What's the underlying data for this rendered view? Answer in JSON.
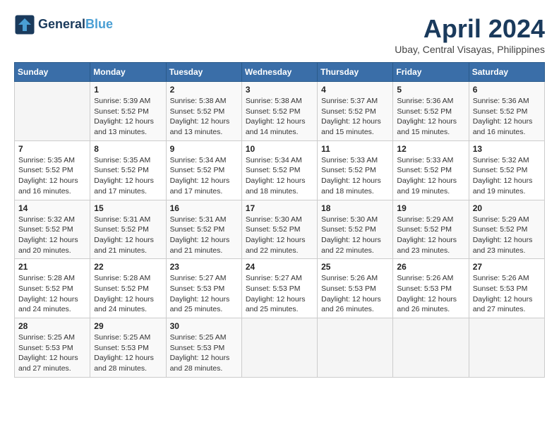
{
  "header": {
    "logo_line1": "General",
    "logo_line2": "Blue",
    "month_title": "April 2024",
    "location": "Ubay, Central Visayas, Philippines"
  },
  "days_of_week": [
    "Sunday",
    "Monday",
    "Tuesday",
    "Wednesday",
    "Thursday",
    "Friday",
    "Saturday"
  ],
  "weeks": [
    [
      {
        "day": "",
        "info": ""
      },
      {
        "day": "1",
        "info": "Sunrise: 5:39 AM\nSunset: 5:52 PM\nDaylight: 12 hours\nand 13 minutes."
      },
      {
        "day": "2",
        "info": "Sunrise: 5:38 AM\nSunset: 5:52 PM\nDaylight: 12 hours\nand 13 minutes."
      },
      {
        "day": "3",
        "info": "Sunrise: 5:38 AM\nSunset: 5:52 PM\nDaylight: 12 hours\nand 14 minutes."
      },
      {
        "day": "4",
        "info": "Sunrise: 5:37 AM\nSunset: 5:52 PM\nDaylight: 12 hours\nand 15 minutes."
      },
      {
        "day": "5",
        "info": "Sunrise: 5:36 AM\nSunset: 5:52 PM\nDaylight: 12 hours\nand 15 minutes."
      },
      {
        "day": "6",
        "info": "Sunrise: 5:36 AM\nSunset: 5:52 PM\nDaylight: 12 hours\nand 16 minutes."
      }
    ],
    [
      {
        "day": "7",
        "info": "Sunrise: 5:35 AM\nSunset: 5:52 PM\nDaylight: 12 hours\nand 16 minutes."
      },
      {
        "day": "8",
        "info": "Sunrise: 5:35 AM\nSunset: 5:52 PM\nDaylight: 12 hours\nand 17 minutes."
      },
      {
        "day": "9",
        "info": "Sunrise: 5:34 AM\nSunset: 5:52 PM\nDaylight: 12 hours\nand 17 minutes."
      },
      {
        "day": "10",
        "info": "Sunrise: 5:34 AM\nSunset: 5:52 PM\nDaylight: 12 hours\nand 18 minutes."
      },
      {
        "day": "11",
        "info": "Sunrise: 5:33 AM\nSunset: 5:52 PM\nDaylight: 12 hours\nand 18 minutes."
      },
      {
        "day": "12",
        "info": "Sunrise: 5:33 AM\nSunset: 5:52 PM\nDaylight: 12 hours\nand 19 minutes."
      },
      {
        "day": "13",
        "info": "Sunrise: 5:32 AM\nSunset: 5:52 PM\nDaylight: 12 hours\nand 19 minutes."
      }
    ],
    [
      {
        "day": "14",
        "info": "Sunrise: 5:32 AM\nSunset: 5:52 PM\nDaylight: 12 hours\nand 20 minutes."
      },
      {
        "day": "15",
        "info": "Sunrise: 5:31 AM\nSunset: 5:52 PM\nDaylight: 12 hours\nand 21 minutes."
      },
      {
        "day": "16",
        "info": "Sunrise: 5:31 AM\nSunset: 5:52 PM\nDaylight: 12 hours\nand 21 minutes."
      },
      {
        "day": "17",
        "info": "Sunrise: 5:30 AM\nSunset: 5:52 PM\nDaylight: 12 hours\nand 22 minutes."
      },
      {
        "day": "18",
        "info": "Sunrise: 5:30 AM\nSunset: 5:52 PM\nDaylight: 12 hours\nand 22 minutes."
      },
      {
        "day": "19",
        "info": "Sunrise: 5:29 AM\nSunset: 5:52 PM\nDaylight: 12 hours\nand 23 minutes."
      },
      {
        "day": "20",
        "info": "Sunrise: 5:29 AM\nSunset: 5:52 PM\nDaylight: 12 hours\nand 23 minutes."
      }
    ],
    [
      {
        "day": "21",
        "info": "Sunrise: 5:28 AM\nSunset: 5:52 PM\nDaylight: 12 hours\nand 24 minutes."
      },
      {
        "day": "22",
        "info": "Sunrise: 5:28 AM\nSunset: 5:52 PM\nDaylight: 12 hours\nand 24 minutes."
      },
      {
        "day": "23",
        "info": "Sunrise: 5:27 AM\nSunset: 5:53 PM\nDaylight: 12 hours\nand 25 minutes."
      },
      {
        "day": "24",
        "info": "Sunrise: 5:27 AM\nSunset: 5:53 PM\nDaylight: 12 hours\nand 25 minutes."
      },
      {
        "day": "25",
        "info": "Sunrise: 5:26 AM\nSunset: 5:53 PM\nDaylight: 12 hours\nand 26 minutes."
      },
      {
        "day": "26",
        "info": "Sunrise: 5:26 AM\nSunset: 5:53 PM\nDaylight: 12 hours\nand 26 minutes."
      },
      {
        "day": "27",
        "info": "Sunrise: 5:26 AM\nSunset: 5:53 PM\nDaylight: 12 hours\nand 27 minutes."
      }
    ],
    [
      {
        "day": "28",
        "info": "Sunrise: 5:25 AM\nSunset: 5:53 PM\nDaylight: 12 hours\nand 27 minutes."
      },
      {
        "day": "29",
        "info": "Sunrise: 5:25 AM\nSunset: 5:53 PM\nDaylight: 12 hours\nand 28 minutes."
      },
      {
        "day": "30",
        "info": "Sunrise: 5:25 AM\nSunset: 5:53 PM\nDaylight: 12 hours\nand 28 minutes."
      },
      {
        "day": "",
        "info": ""
      },
      {
        "day": "",
        "info": ""
      },
      {
        "day": "",
        "info": ""
      },
      {
        "day": "",
        "info": ""
      }
    ]
  ]
}
